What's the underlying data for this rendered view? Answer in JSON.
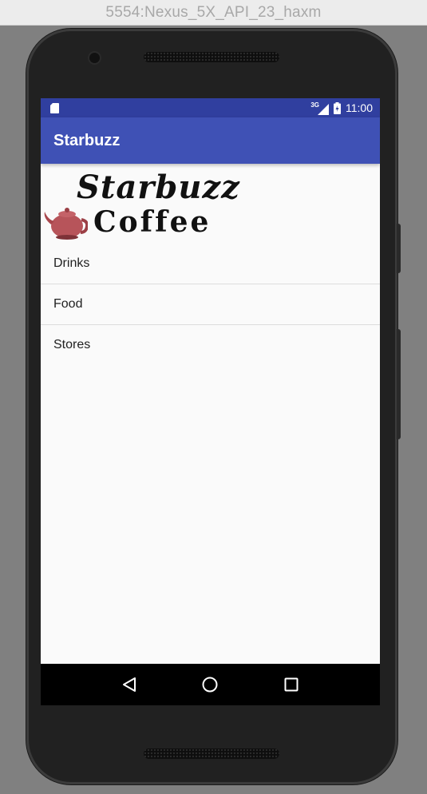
{
  "window": {
    "title": "5554:Nexus_5X_API_23_haxm"
  },
  "status_bar": {
    "time": "11:00",
    "network": "3G",
    "color": "#303f9f"
  },
  "app_bar": {
    "title": "Starbuzz",
    "color": "#3f51b5"
  },
  "logo": {
    "line1": "Starbuzz",
    "line2": "Coffee"
  },
  "options": [
    {
      "label": "Drinks"
    },
    {
      "label": "Food"
    },
    {
      "label": "Stores"
    }
  ],
  "nav_bar": {
    "icons": [
      "back-icon",
      "home-icon",
      "recents-icon"
    ]
  }
}
